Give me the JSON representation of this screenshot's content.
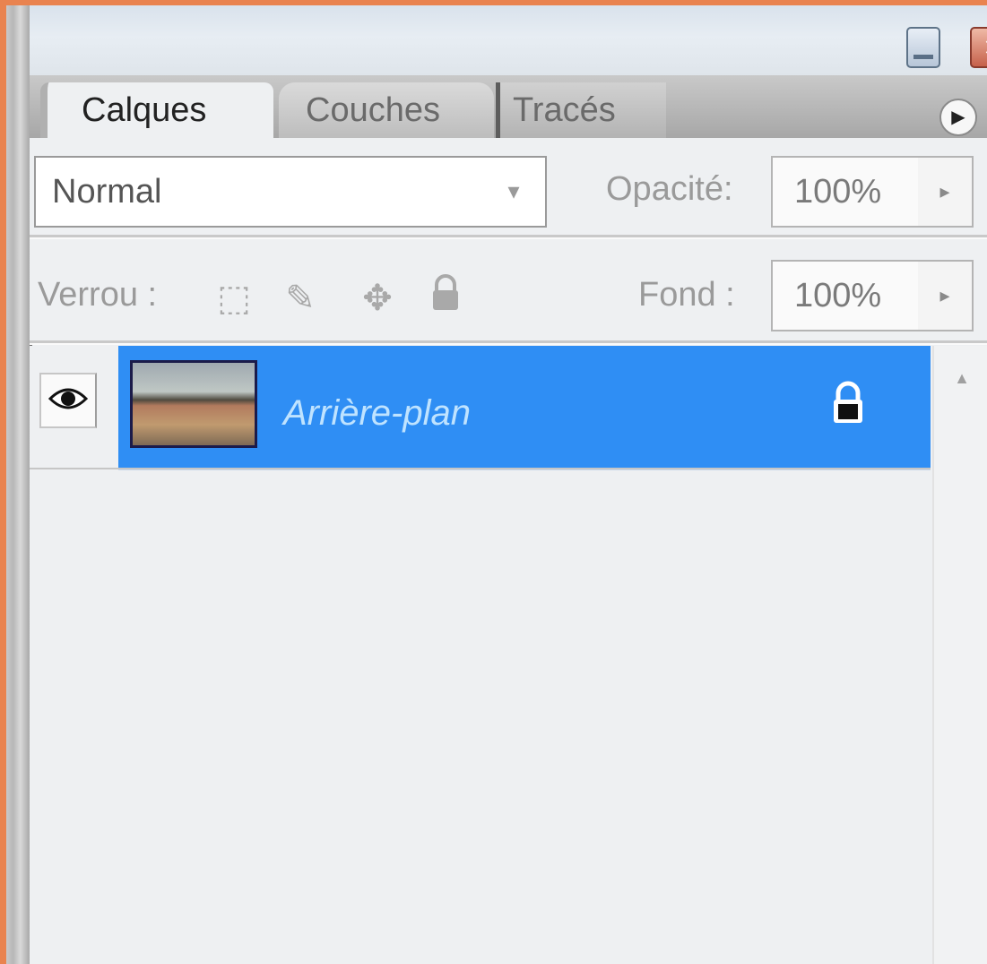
{
  "tabs": [
    {
      "label": "Calques",
      "active": true
    },
    {
      "label": "Couches",
      "active": false
    },
    {
      "label": "Tracés",
      "active": false
    }
  ],
  "blend_mode": {
    "value": "Normal"
  },
  "opacity": {
    "label": "Opacité:",
    "value": "100%"
  },
  "lock": {
    "label": "Verrou :"
  },
  "fill": {
    "label": "Fond :",
    "value": "100%"
  },
  "layers": [
    {
      "name": "Arrière-plan",
      "selected": true,
      "visible": true,
      "locked": true
    }
  ],
  "colors": {
    "selection": "#2f8ef4",
    "layer_name": "#bfe3ff",
    "frame": "#e9834f"
  },
  "icons": {
    "minimize": "minimize-icon",
    "close": "close-icon",
    "panel_menu": "panel-menu-icon",
    "lock_transparency": "lock-transparency-icon",
    "lock_paint": "lock-paint-icon",
    "lock_move": "lock-move-icon",
    "lock_all": "lock-all-icon",
    "visibility": "eye-icon",
    "layer_lock": "lock-icon"
  }
}
